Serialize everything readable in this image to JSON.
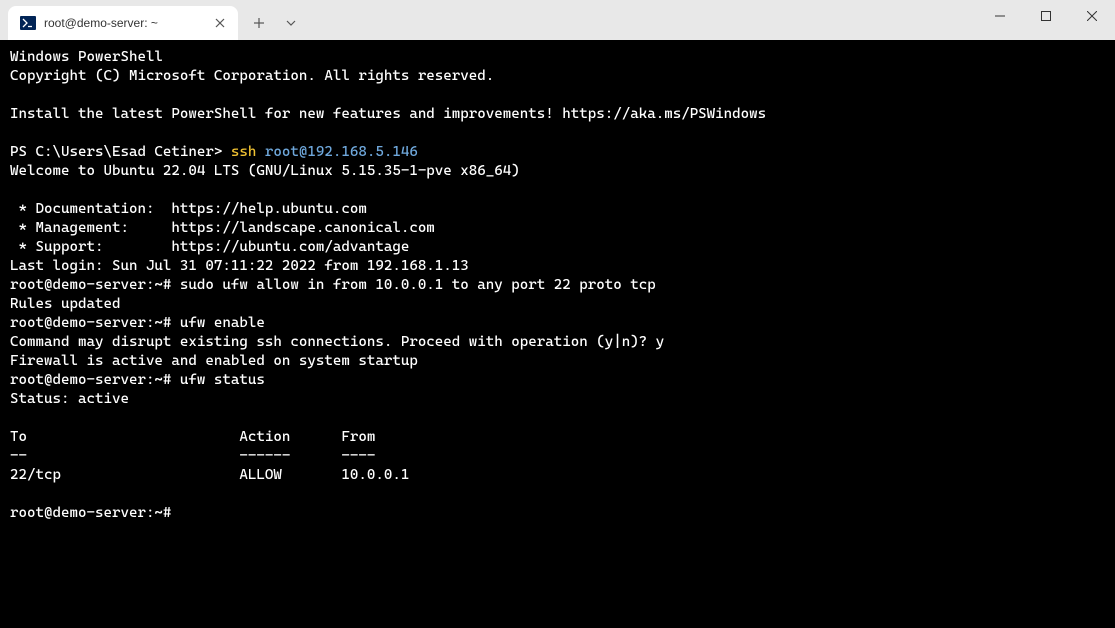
{
  "window": {
    "tab_title": "root@demo-server: ~",
    "icons": {
      "app": "powershell-icon",
      "close_tab": "close-icon",
      "new_tab": "plus-icon",
      "dropdown": "chevron-down-icon",
      "minimize": "minimize-icon",
      "maximize": "maximize-icon",
      "close_window": "close-icon"
    }
  },
  "terminal": {
    "lines": [
      {
        "segs": [
          {
            "t": "Windows PowerShell"
          }
        ]
      },
      {
        "segs": [
          {
            "t": "Copyright (C) Microsoft Corporation. All rights reserved."
          }
        ]
      },
      {
        "segs": [
          {
            "t": ""
          }
        ]
      },
      {
        "segs": [
          {
            "t": "Install the latest PowerShell for new features and improvements! https://aka.ms/PSWindows"
          }
        ]
      },
      {
        "segs": [
          {
            "t": ""
          }
        ]
      },
      {
        "segs": [
          {
            "t": "PS C:\\Users\\Esad Cetiner> "
          },
          {
            "t": "ssh ",
            "cls": "c-yellow"
          },
          {
            "t": "root@192.168.5.146",
            "cls": "c-blue"
          }
        ]
      },
      {
        "segs": [
          {
            "t": "Welcome to Ubuntu 22.04 LTS (GNU/Linux 5.15.35-1-pve x86_64)"
          }
        ]
      },
      {
        "segs": [
          {
            "t": ""
          }
        ]
      },
      {
        "segs": [
          {
            "t": " * Documentation:  https://help.ubuntu.com"
          }
        ]
      },
      {
        "segs": [
          {
            "t": " * Management:     https://landscape.canonical.com"
          }
        ]
      },
      {
        "segs": [
          {
            "t": " * Support:        https://ubuntu.com/advantage"
          }
        ]
      },
      {
        "segs": [
          {
            "t": "Last login: Sun Jul 31 07:11:22 2022 from 192.168.1.13"
          }
        ]
      },
      {
        "segs": [
          {
            "t": "root@demo-server:~# sudo ufw allow in from 10.0.0.1 to any port 22 proto tcp"
          }
        ]
      },
      {
        "segs": [
          {
            "t": "Rules updated"
          }
        ]
      },
      {
        "segs": [
          {
            "t": "root@demo-server:~# ufw enable"
          }
        ]
      },
      {
        "segs": [
          {
            "t": "Command may disrupt existing ssh connections. Proceed with operation (y|n)? y"
          }
        ]
      },
      {
        "segs": [
          {
            "t": "Firewall is active and enabled on system startup"
          }
        ]
      },
      {
        "segs": [
          {
            "t": "root@demo-server:~# ufw status"
          }
        ]
      },
      {
        "segs": [
          {
            "t": "Status: active"
          }
        ]
      },
      {
        "segs": [
          {
            "t": ""
          }
        ]
      },
      {
        "segs": [
          {
            "t": "To                         Action      From"
          }
        ]
      },
      {
        "segs": [
          {
            "t": "--                         ------      ----"
          }
        ]
      },
      {
        "segs": [
          {
            "t": "22/tcp                     ALLOW       10.0.0.1"
          }
        ]
      },
      {
        "segs": [
          {
            "t": ""
          }
        ]
      },
      {
        "segs": [
          {
            "t": "root@demo-server:~# "
          }
        ],
        "cursor": true
      }
    ]
  }
}
